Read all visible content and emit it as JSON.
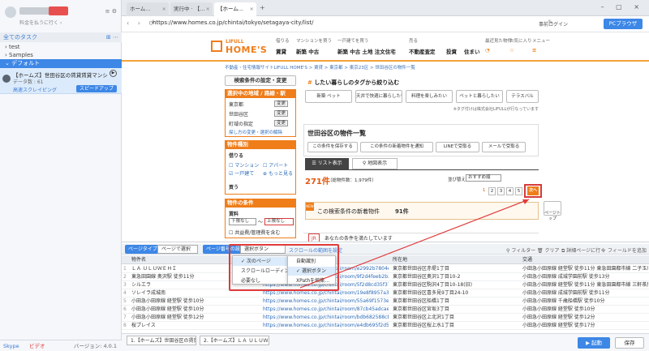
{
  "sidebar": {
    "login_text": "料金を払うに行く ›",
    "section_title": "全てのタスク",
    "tree": [
      {
        "label": "test"
      },
      {
        "label": "Samples"
      },
      {
        "label": "デフォルト"
      }
    ],
    "task": {
      "title": "【ホームズ】世田谷区の賃貸賃貸マンション",
      "data_label": "データ数 : 61",
      "mode_label": "高速スクレイピング",
      "speed_label": "スピードアップ"
    },
    "footer": {
      "s1": "Skype",
      "s2": "ビデオ",
      "version": "バージョン: 4.0.1"
    }
  },
  "browser": {
    "tabs": [
      {
        "label": "ホーム..."
      },
      {
        "label": "実行中 · 【..."
      },
      {
        "label": "【ホーム..."
      }
    ],
    "url": "https://www.homes.co.jp/chintai/tokyo/setagaya-city/list/",
    "login_label": "事前ログイン",
    "pc_label": "PCブラウザ"
  },
  "site": {
    "logo_top": "LIFULL",
    "logo_main": "HOME'S",
    "nav": [
      {
        "top": "借りる",
        "sub": "賃貸"
      },
      {
        "top": "マンションを買う",
        "sub": "新築 中古"
      },
      {
        "top": "一戸建てを買う",
        "sub": "新築 中古 土地 注文住宅"
      },
      {
        "top": "売る",
        "sub": "不動産査定"
      },
      {
        "top": "",
        "sub": "投資"
      },
      {
        "top": "",
        "sub": "住まい"
      },
      {
        "top": "最近見た物件",
        "sub": ""
      },
      {
        "top": "お気に入り",
        "sub": ""
      },
      {
        "top": "メニュー",
        "sub": ""
      }
    ],
    "breadcrumb": "不動産・住宅情報サイトLIFULL HOME'S > 賃貸 > 東京都 > 東京23区 > 世田谷区の物件一覧",
    "cond_button": "検索条件の設定・変更",
    "area_head": "選択中の地域 / 路線・駅",
    "area_items": [
      "東京都",
      "世田谷区",
      "町域の指定"
    ],
    "change_label": "変更",
    "area_link": "探し方の変更・選択の解除",
    "type_head": "物件種別",
    "borrow_label": "借りる",
    "type_items": [
      "マンション",
      "アパート",
      "一戸建て",
      "もっと見る"
    ],
    "buy_label": "買う",
    "cond_head": "物件の条件",
    "rent_label": "賃料",
    "rent_from": "下限なし",
    "rent_to": "上限なし",
    "fee_label": "共益費/管理費を含む",
    "hash_head": "したい暮らしのタグから絞り込む",
    "tags": [
      "新築 ペット",
      "天井で快適に暮らしたい",
      "料理を楽しみたい",
      "ペットと暮らしたい",
      "テラスバル"
    ],
    "tag_note": "※タグ付けは株式会社LIFULLが行なっています",
    "list_title": "世田谷区の物件一覧",
    "actions": [
      "この条件を保存する",
      "この条件の新着物件を通知",
      "LINEで受取る",
      "メールで受取る"
    ],
    "tab_list": "リスト表示",
    "tab_map": "地図表示",
    "count_main": "271件",
    "count_sub": "（総物件数：1,979件）",
    "sort_label": "並び替え",
    "sort_value": "おすすめ順",
    "pages": [
      "1",
      "2",
      "3",
      "4",
      "5"
    ],
    "next_label": "次へ",
    "new_badge": "NEW",
    "new_text": "この検索条件の新着物件",
    "new_count": "91件",
    "top_label": "ページトップ",
    "jr_label": "JR",
    "jr_text": "あなたの条件を満たしています"
  },
  "extract": {
    "page_type_label": "ページタイプ",
    "page_type_value": "ページで選択",
    "page_paging_label": "ページ番号の設定",
    "paging_value": "選択ボタン",
    "scroll_link": "スクロールの範囲を設定",
    "filter_label": "フィルター",
    "clear_label": "クリア",
    "detail_label": "詳細ページに行く",
    "add_field": "フィールドを追加",
    "columns": [
      "物件名",
      "",
      "所在地",
      "交通"
    ],
    "rows": [
      {
        "name": "ＬＡ ＵＬＵＷＥＨＩ",
        "url": "https://www.homes.co.jp/chintai/room/e2992b7804e799bbaa45c3e...",
        "addr": "東京都世田谷区赤堤1丁目",
        "traffic": "小田急小田原線 経堂駅 徒歩11分 東急田園都市線 二子玉川..."
      },
      {
        "name": "東急田園線 奥沢駅 徒歩11分",
        "url": "https://www.homes.co.jp/chintai/room/9f2d4feeb2b351a2c7582bd...",
        "addr": "東京都世田谷区奥沢1丁目10-2",
        "traffic": "小田急小田原線 成城学園前駅 徒歩13分"
      },
      {
        "name": "シルエラ",
        "url": "https://www.homes.co.jp/chintai/room/5f2d8cd35f37a27a57369f14...",
        "addr": "東京都世田谷区駒沢4丁目10-18(旧)",
        "traffic": "小田急小田原線 経堂駅 徒歩11分 東急田園都市線 三軒茶屋駅..."
      },
      {
        "name": "ソレイラ成城南",
        "url": "https://www.homes.co.jp/chintai/room/19e8f8957a3c2c9f0d52e42...",
        "addr": "東京都世田谷区喜多見9丁目24-10",
        "traffic": "小田急小田原線 成城学園前駅 徒歩11分"
      },
      {
        "name": "小田急小田原線 経堂駅 徒歩10分",
        "url": "https://www.homes.co.jp/chintai/room/55a69f1573ebd96b796d83...",
        "addr": "東京都世田谷区船橋1丁目",
        "traffic": "小田急小田原線 千歳船橋駅 徒歩10分"
      },
      {
        "name": "小田急小田原線 経堂駅 徒歩10分",
        "url": "https://www.homes.co.jp/chintai/room/87cb45adcaeb74f8c39b48...",
        "addr": "東京都世田谷区宮坂3丁目",
        "traffic": "小田急小田原線 経堂駅 徒歩10分"
      },
      {
        "name": "小田急小田原線 経堂駅 徒歩12分",
        "url": "https://www.homes.co.jp/chintai/room/bdb682588cb525095f0c8b5...",
        "addr": "東京都世田谷区上北沢1丁目",
        "traffic": "小田急小田原線 経堂駅 徒歩12分"
      },
      {
        "name": "桜プレイス",
        "url": "https://www.homes.co.jp/chintai/room/e4db695f2d5fd7f6a2c53cd...",
        "addr": "東京都世田谷区桜上水1丁目",
        "traffic": "小田急小田原線 経堂駅 徒歩17分"
      }
    ],
    "dropdown1": [
      "次のページ",
      "スクロールローディング",
      "必要なし"
    ],
    "dropdown2": [
      "自動識別",
      "選択ボタン",
      "XPathを編集..."
    ]
  },
  "bottom": {
    "tasks": [
      "1.【ホームズ】世田谷区の賃貸賃",
      "2.【ホームズ】ＬＡ ＵＬＵＷＥ"
    ],
    "run_label": "起動",
    "save_label": "保存"
  }
}
